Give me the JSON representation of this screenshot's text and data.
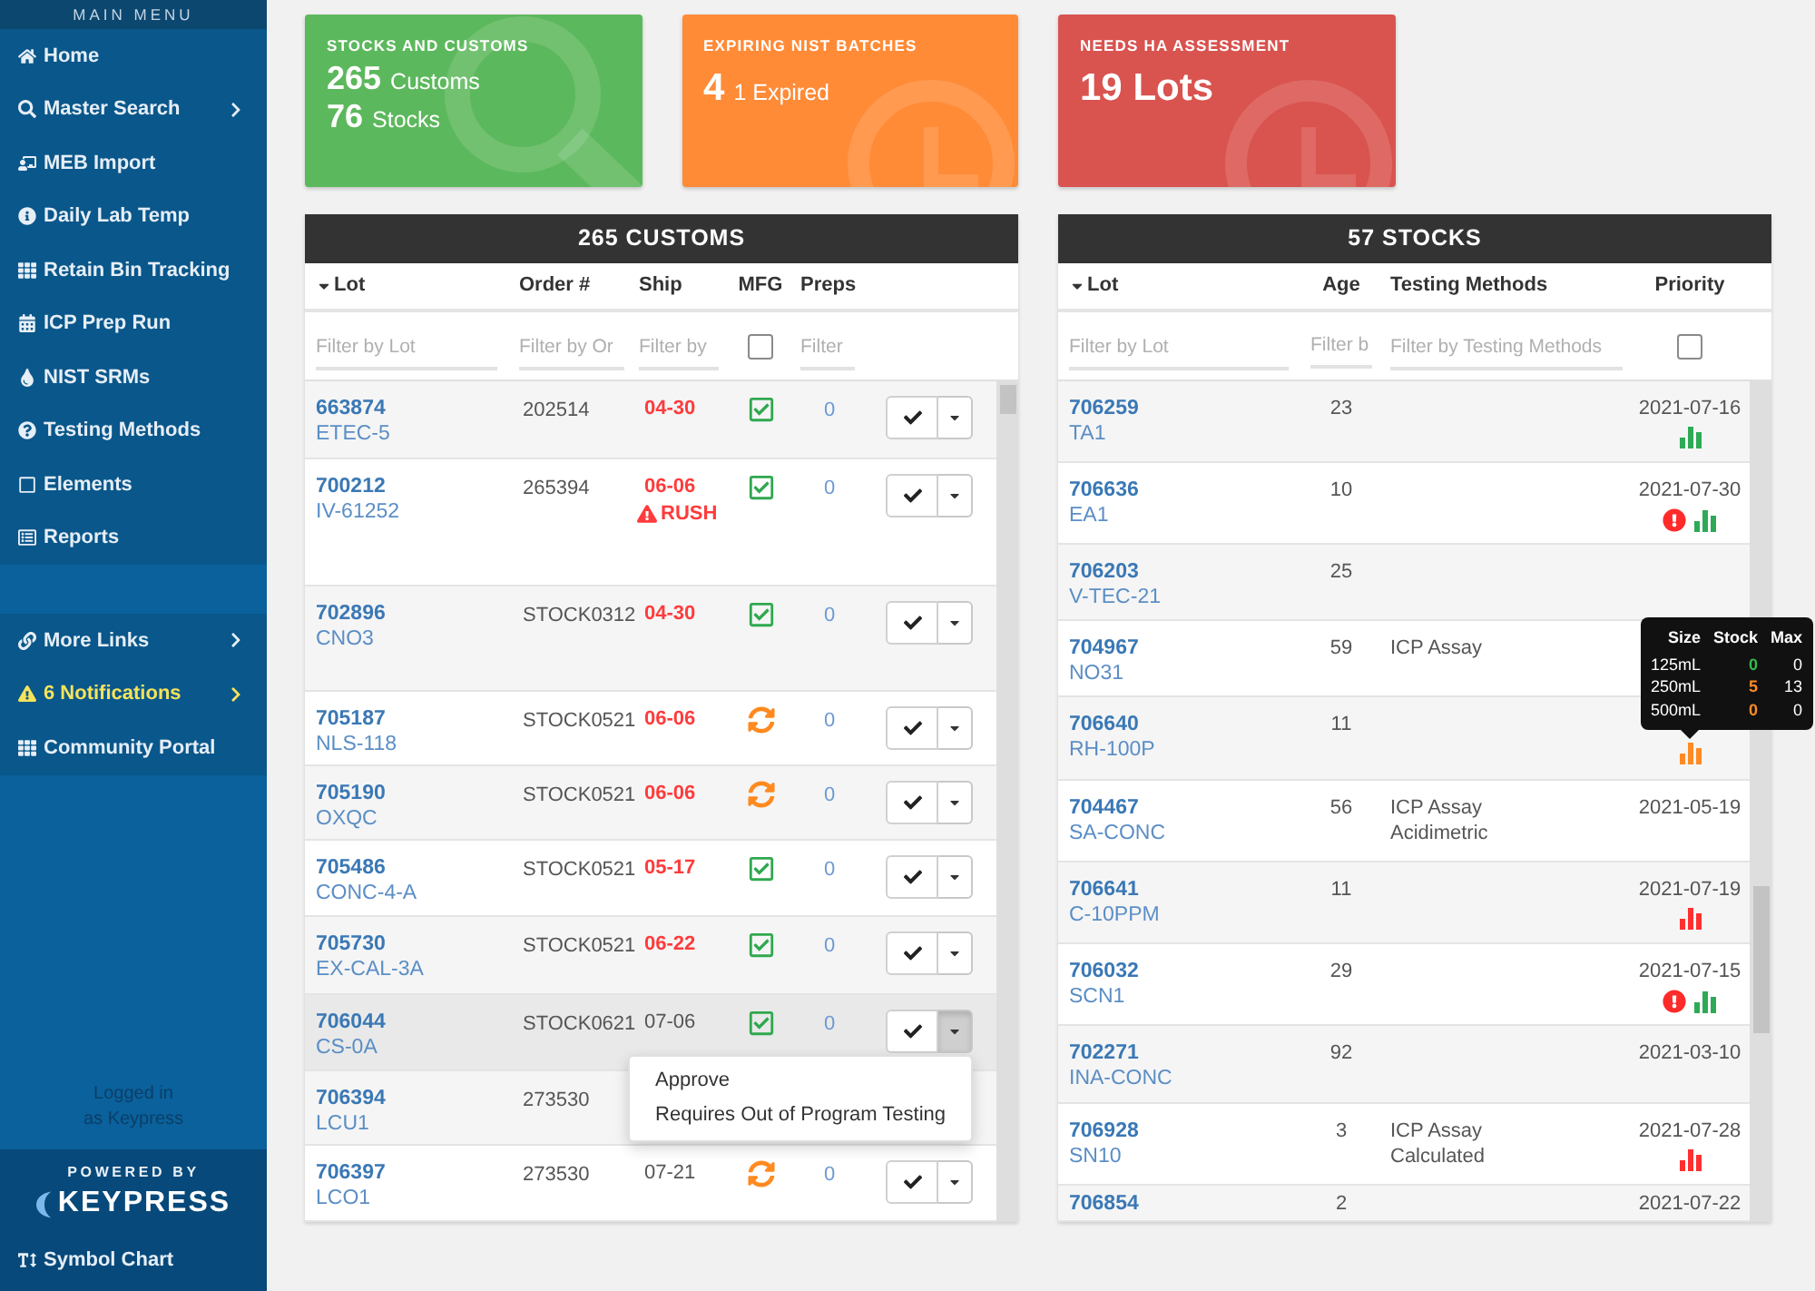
{
  "sidebar": {
    "title": "MAIN MENU",
    "menu": [
      {
        "label": "Home",
        "submenu": false
      },
      {
        "label": "Master Search",
        "submenu": true
      },
      {
        "label": "MEB Import",
        "submenu": false
      },
      {
        "label": "Daily Lab Temp",
        "submenu": false
      },
      {
        "label": "Retain Bin Tracking",
        "submenu": false
      },
      {
        "label": "ICP Prep Run",
        "submenu": false
      },
      {
        "label": "NIST SRMs",
        "submenu": false
      },
      {
        "label": "Testing Methods",
        "submenu": false
      },
      {
        "label": "Elements",
        "submenu": false
      },
      {
        "label": "Reports",
        "submenu": false
      }
    ],
    "links": [
      {
        "label": "More Links",
        "submenu": true,
        "warning": false
      },
      {
        "label": "6 Notifications",
        "submenu": true,
        "warning": true
      },
      {
        "label": "Community Portal",
        "submenu": false,
        "warning": false
      }
    ],
    "login": "Logged in as Keypress",
    "footer": {
      "powered_by": "POWERED BY",
      "brand": "KEYPRESS",
      "link": "Symbol Chart"
    }
  },
  "cards": [
    {
      "title": "STOCKS AND CUSTOMS",
      "color": "#5cb85c",
      "lines": [
        {
          "value": "265",
          "label": "Customs"
        },
        {
          "value": "76",
          "label": "Stocks"
        }
      ]
    },
    {
      "title": "EXPIRING NIST BATCHES",
      "color": "#ff8b37",
      "lines": [
        {
          "value": "4",
          "label": "1 Expired"
        }
      ]
    },
    {
      "title": "NEEDS HA ASSESSMENT",
      "color": "#d9534f",
      "lines": [
        {
          "value": "19 Lots"
        }
      ]
    }
  ],
  "customs": {
    "title": "265 CUSTOMS",
    "columns": [
      {
        "label": "Lot",
        "sorted": true
      },
      {
        "label": "Order #",
        "sorted": false
      },
      {
        "label": "Ship",
        "sorted": false
      },
      {
        "label": "MFG",
        "sorted": false
      },
      {
        "label": "Preps",
        "sorted": false
      }
    ],
    "filters": [
      {
        "kind": "text",
        "placeholder": "Filter by Lot"
      },
      {
        "kind": "text",
        "placeholder": "Filter by Or"
      },
      {
        "kind": "text",
        "placeholder": "Filter by"
      },
      {
        "kind": "checkbox",
        "checked": false
      },
      {
        "kind": "text",
        "placeholder": "Filter"
      }
    ],
    "row_menu": [
      "Approve",
      "Requires Out of Program Testing"
    ],
    "rows": [
      {
        "lot": "663874",
        "name": "ETEC-5",
        "order": "202514",
        "ship": "04-30",
        "ship_late": true,
        "mfg_done": true,
        "preps": "0",
        "highlighted": false,
        "actions": {
          "menu_open": false
        }
      },
      {
        "lot": "700212",
        "name": "IV-61252",
        "order": "265394",
        "ship": "06-06",
        "ship_late": true,
        "flag": "RUSH",
        "mfg_done": true,
        "preps": "0",
        "highlighted": false,
        "actions": {
          "menu_open": false
        }
      },
      {
        "lot": "702896",
        "name": "CNO3",
        "order": "STOCK0312",
        "ship": "04-30",
        "ship_late": true,
        "mfg_done": true,
        "preps": "0",
        "highlighted": false,
        "actions": {
          "menu_open": false
        }
      },
      {
        "lot": "705187",
        "name": "NLS-118",
        "order": "STOCK0521",
        "ship": "06-06",
        "ship_late": true,
        "mfg_done": false,
        "preps": "0",
        "highlighted": false,
        "actions": {
          "menu_open": false
        }
      },
      {
        "lot": "705190",
        "name": "OXQC",
        "order": "STOCK0521",
        "ship": "06-06",
        "ship_late": true,
        "mfg_done": false,
        "preps": "0",
        "highlighted": false,
        "actions": {
          "menu_open": false
        }
      },
      {
        "lot": "705486",
        "name": "CONC-4-A",
        "order": "STOCK0521",
        "ship": "05-17",
        "ship_late": true,
        "mfg_done": true,
        "preps": "0",
        "highlighted": false,
        "actions": {
          "menu_open": false
        }
      },
      {
        "lot": "705730",
        "name": "EX-CAL-3A",
        "order": "STOCK0521",
        "ship": "06-22",
        "ship_late": true,
        "mfg_done": true,
        "preps": "0",
        "highlighted": false,
        "actions": {
          "menu_open": false
        }
      },
      {
        "lot": "706044",
        "name": "CS-0A",
        "order": "STOCK0621",
        "ship": "07-06",
        "ship_late": false,
        "mfg_done": true,
        "preps": "0",
        "highlighted": true,
        "actions": {
          "menu_open": true
        }
      },
      {
        "lot": "706394",
        "name": "LCU1",
        "order": "273530",
        "highlighted": false
      },
      {
        "lot": "706397",
        "name": "LCO1",
        "order": "273530",
        "ship": "07-21",
        "ship_late": false,
        "mfg_done": false,
        "preps": "0",
        "highlighted": false,
        "actions": {
          "menu_open": false
        }
      }
    ]
  },
  "stocks": {
    "title": "57 STOCKS",
    "columns": [
      {
        "label": "Lot",
        "sorted": true
      },
      {
        "label": "Age",
        "sorted": false
      },
      {
        "label": "Testing Methods",
        "sorted": false
      },
      {
        "label": "Priority",
        "sorted": false
      }
    ],
    "filters": [
      {
        "kind": "text",
        "placeholder": "Filter by Lot"
      },
      {
        "kind": "text",
        "placeholder": "Filter b"
      },
      {
        "kind": "text",
        "placeholder": "Filter by Testing Methods"
      },
      {
        "kind": "checkbox",
        "checked": false
      }
    ],
    "rows": [
      {
        "lot": "706259",
        "name": "TA1",
        "age": "23",
        "priority": {
          "date": "2021-07-16",
          "alert": false,
          "color": "#2eaa56"
        }
      },
      {
        "lot": "706636",
        "name": "EA1",
        "age": "10",
        "priority": {
          "date": "2021-07-30",
          "alert": true,
          "color": "#2eaa56"
        }
      },
      {
        "lot": "706203",
        "name": "V-TEC-21",
        "age": "25"
      },
      {
        "lot": "704967",
        "name": "NO31",
        "age": "59",
        "methods": [
          "ICP Assay"
        ]
      },
      {
        "lot": "706640",
        "name": "RH-100P",
        "age": "11",
        "priority": {
          "alert": false,
          "color": "#ff8b25"
        },
        "tooltip": {
          "columns": [
            "Size",
            "Stock",
            "Max"
          ],
          "rows": [
            {
              "size": "125mL",
              "stock": "0",
              "color": "#35b84f",
              "max": "0"
            },
            {
              "size": "250mL",
              "stock": "5",
              "color": "#ff8b25",
              "max": "13"
            },
            {
              "size": "500mL",
              "stock": "0",
              "color": "#ff8b25",
              "max": "0"
            }
          ]
        }
      },
      {
        "lot": "704467",
        "name": "SA-CONC",
        "age": "56",
        "methods": [
          "ICP Assay",
          "Acidimetric"
        ],
        "priority": {
          "date": "2021-05-19",
          "alert": false
        }
      },
      {
        "lot": "706641",
        "name": "C-10PPM",
        "age": "11",
        "priority": {
          "date": "2021-07-19",
          "alert": false,
          "color": "#ff3030"
        }
      },
      {
        "lot": "706032",
        "name": "SCN1",
        "age": "29",
        "priority": {
          "date": "2021-07-15",
          "alert": true,
          "color": "#2eaa56"
        }
      },
      {
        "lot": "702271",
        "name": "INA-CONC",
        "age": "92",
        "priority": {
          "date": "2021-03-10",
          "alert": false
        }
      },
      {
        "lot": "706928",
        "name": "SN10",
        "age": "3",
        "methods": [
          "ICP Assay",
          "Calculated"
        ],
        "priority": {
          "date": "2021-07-28",
          "alert": false,
          "color": "#ff3030"
        }
      },
      {
        "lot": "706854",
        "age": "2",
        "priority": {
          "date": "2021-07-22",
          "alert": false
        }
      }
    ]
  }
}
